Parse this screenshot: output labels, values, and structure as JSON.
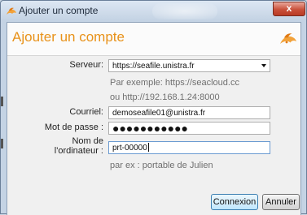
{
  "window": {
    "title": "Ajouter un compte",
    "close_glyph": "x"
  },
  "header": {
    "title": "Ajouter un compte",
    "logo_icon": "seafile-logo-icon"
  },
  "form": {
    "server": {
      "label": "Serveur:",
      "value": "https://seafile.unistra.fr",
      "hint1": "Par exemple: https://seacloud.cc",
      "hint2": "ou http://192.168.1.24:8000"
    },
    "email": {
      "label": "Courriel:",
      "value": "demoseafile01@unistra.fr"
    },
    "password": {
      "label": "Mot de passe :",
      "value": "●●●●●●●●●●●"
    },
    "computer": {
      "label_line1": "Nom de",
      "label_line2": "l'ordinateur :",
      "value": "prt-00000",
      "hint": "par ex : portable de Julien"
    }
  },
  "buttons": {
    "connect": "Connexion",
    "cancel": "Annuler"
  },
  "colors": {
    "accent": "#e8921a",
    "default_button_border": "#3c7fb1"
  }
}
